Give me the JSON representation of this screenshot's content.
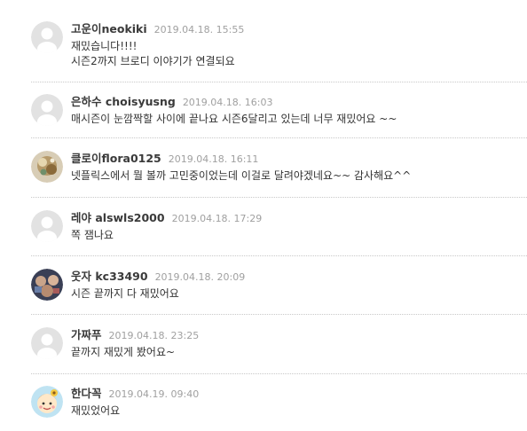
{
  "comments": [
    {
      "author": "고운이neokiki",
      "date": "2019.04.18. 15:55",
      "lines": [
        "재밌습니다!!!!",
        "시즌2까지 브로디 이야기가 연결되요"
      ],
      "avatar": "default-avatar"
    },
    {
      "author": "은하수 choisyusng",
      "date": "2019.04.18. 16:03",
      "lines": [
        "매시즌이 눈깜짝할 사이에 끝나요 시즌6달리고 있는데 너무 재밌어요 ~~"
      ],
      "avatar": "default-avatar"
    },
    {
      "author": "클로이flora0125",
      "date": "2019.04.18. 16:11",
      "lines": [
        "넷플릭스에서 뭘 볼까 고민중이었는데 이걸로 달려야겠네요~~ 감사해요^^"
      ],
      "avatar": "profile-photo"
    },
    {
      "author": "레야 alswls2000",
      "date": "2019.04.18. 17:29",
      "lines": [
        "쪽 잼나요"
      ],
      "avatar": "default-avatar"
    },
    {
      "author": "웃자 kc33490",
      "date": "2019.04.18. 20:09",
      "lines": [
        "시즌 끝까지 다 재밌어요"
      ],
      "avatar": "profile-photo"
    },
    {
      "author": "가짜푸",
      "date": "2019.04.18. 23:25",
      "lines": [
        "끝까지 재밌게 봤어요~"
      ],
      "avatar": "default-avatar"
    },
    {
      "author": "한다꼭",
      "date": "2019.04.19. 09:40",
      "lines": [
        "재밌었어요"
      ],
      "avatar": "cartoon-avatar"
    }
  ],
  "colors": {
    "author": "#3a3a3a",
    "date": "#a0a0a0",
    "text": "#333333",
    "separator": "#c8c8c8",
    "default_avatar_bg": "#e2e2e2",
    "default_avatar_fg": "#ffffff"
  }
}
